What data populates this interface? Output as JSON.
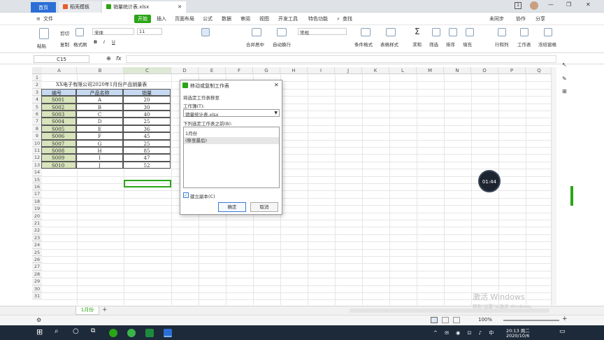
{
  "tabs": {
    "home": "首页",
    "template": "稻壳模板",
    "file": "销量统计表.xlsx"
  },
  "window": {
    "badge": "1"
  },
  "menu": {
    "items": [
      "文件",
      "开始",
      "插入",
      "页面布局",
      "公式",
      "数据",
      "审阅",
      "视图",
      "开发工具",
      "特色功能",
      "查找"
    ],
    "right": [
      "未同步",
      "协作",
      "分享"
    ]
  },
  "ribbon": {
    "paste": "粘贴",
    "cut": "剪切",
    "copy": "复制",
    "format_painter": "格式刷",
    "font": "宋体",
    "size": "11",
    "merge": "合并居中",
    "wrap": "自动换行",
    "numfmt": "常规",
    "cond": "条件格式",
    "table_style": "表格样式",
    "sum": "求和",
    "filter": "筛选",
    "sort": "排序",
    "fill": "填充",
    "rowcol": "行和列",
    "sheet": "工作表",
    "freeze": "冻结窗格"
  },
  "formula": {
    "namebox": "C15",
    "fx": "fx"
  },
  "columns": [
    "A",
    "B",
    "C",
    "D",
    "E",
    "F",
    "G",
    "H",
    "I",
    "J",
    "K",
    "L",
    "M",
    "N",
    "O",
    "P",
    "Q"
  ],
  "sheet": {
    "title": "XX电子有限公司2020年1月份产品销量表",
    "headers": [
      "编号",
      "产品名称",
      "销量"
    ],
    "rows": [
      [
        "S001",
        "A",
        "20"
      ],
      [
        "S002",
        "B",
        "30"
      ],
      [
        "S003",
        "C",
        "40"
      ],
      [
        "S004",
        "D",
        "25"
      ],
      [
        "S005",
        "E",
        "36"
      ],
      [
        "S006",
        "F",
        "45"
      ],
      [
        "S007",
        "G",
        "25"
      ],
      [
        "S008",
        "H",
        "85"
      ],
      [
        "S009",
        "I",
        "47"
      ],
      [
        "S010",
        "J",
        "52"
      ]
    ]
  },
  "dialog": {
    "title": "移动或复制工作表",
    "desc": "将选定工作表移至",
    "workbook_label": "工作簿(T):",
    "workbook_value": "销量统计表.xlsx",
    "before_label": "下列选定工作表之前(B):",
    "list": [
      "1月份",
      "(移至最后)"
    ],
    "copy_label": "建立副本(C)",
    "ok": "确定",
    "cancel": "取消"
  },
  "timer": "01:44",
  "sheettab": "1月份",
  "status": {
    "zoom": "100%"
  },
  "watermark": {
    "line1": "激活 Windows",
    "line2": "转到\"设置\"以激活 Windows。"
  },
  "clock": {
    "time": "20:13 周二",
    "date": "2020/10/6"
  },
  "colors": {
    "accent": "#2aa515",
    "tabblue": "#2b6fd6",
    "header_bg": "#c6d9f1",
    "id_bg": "#d7e4bc"
  }
}
